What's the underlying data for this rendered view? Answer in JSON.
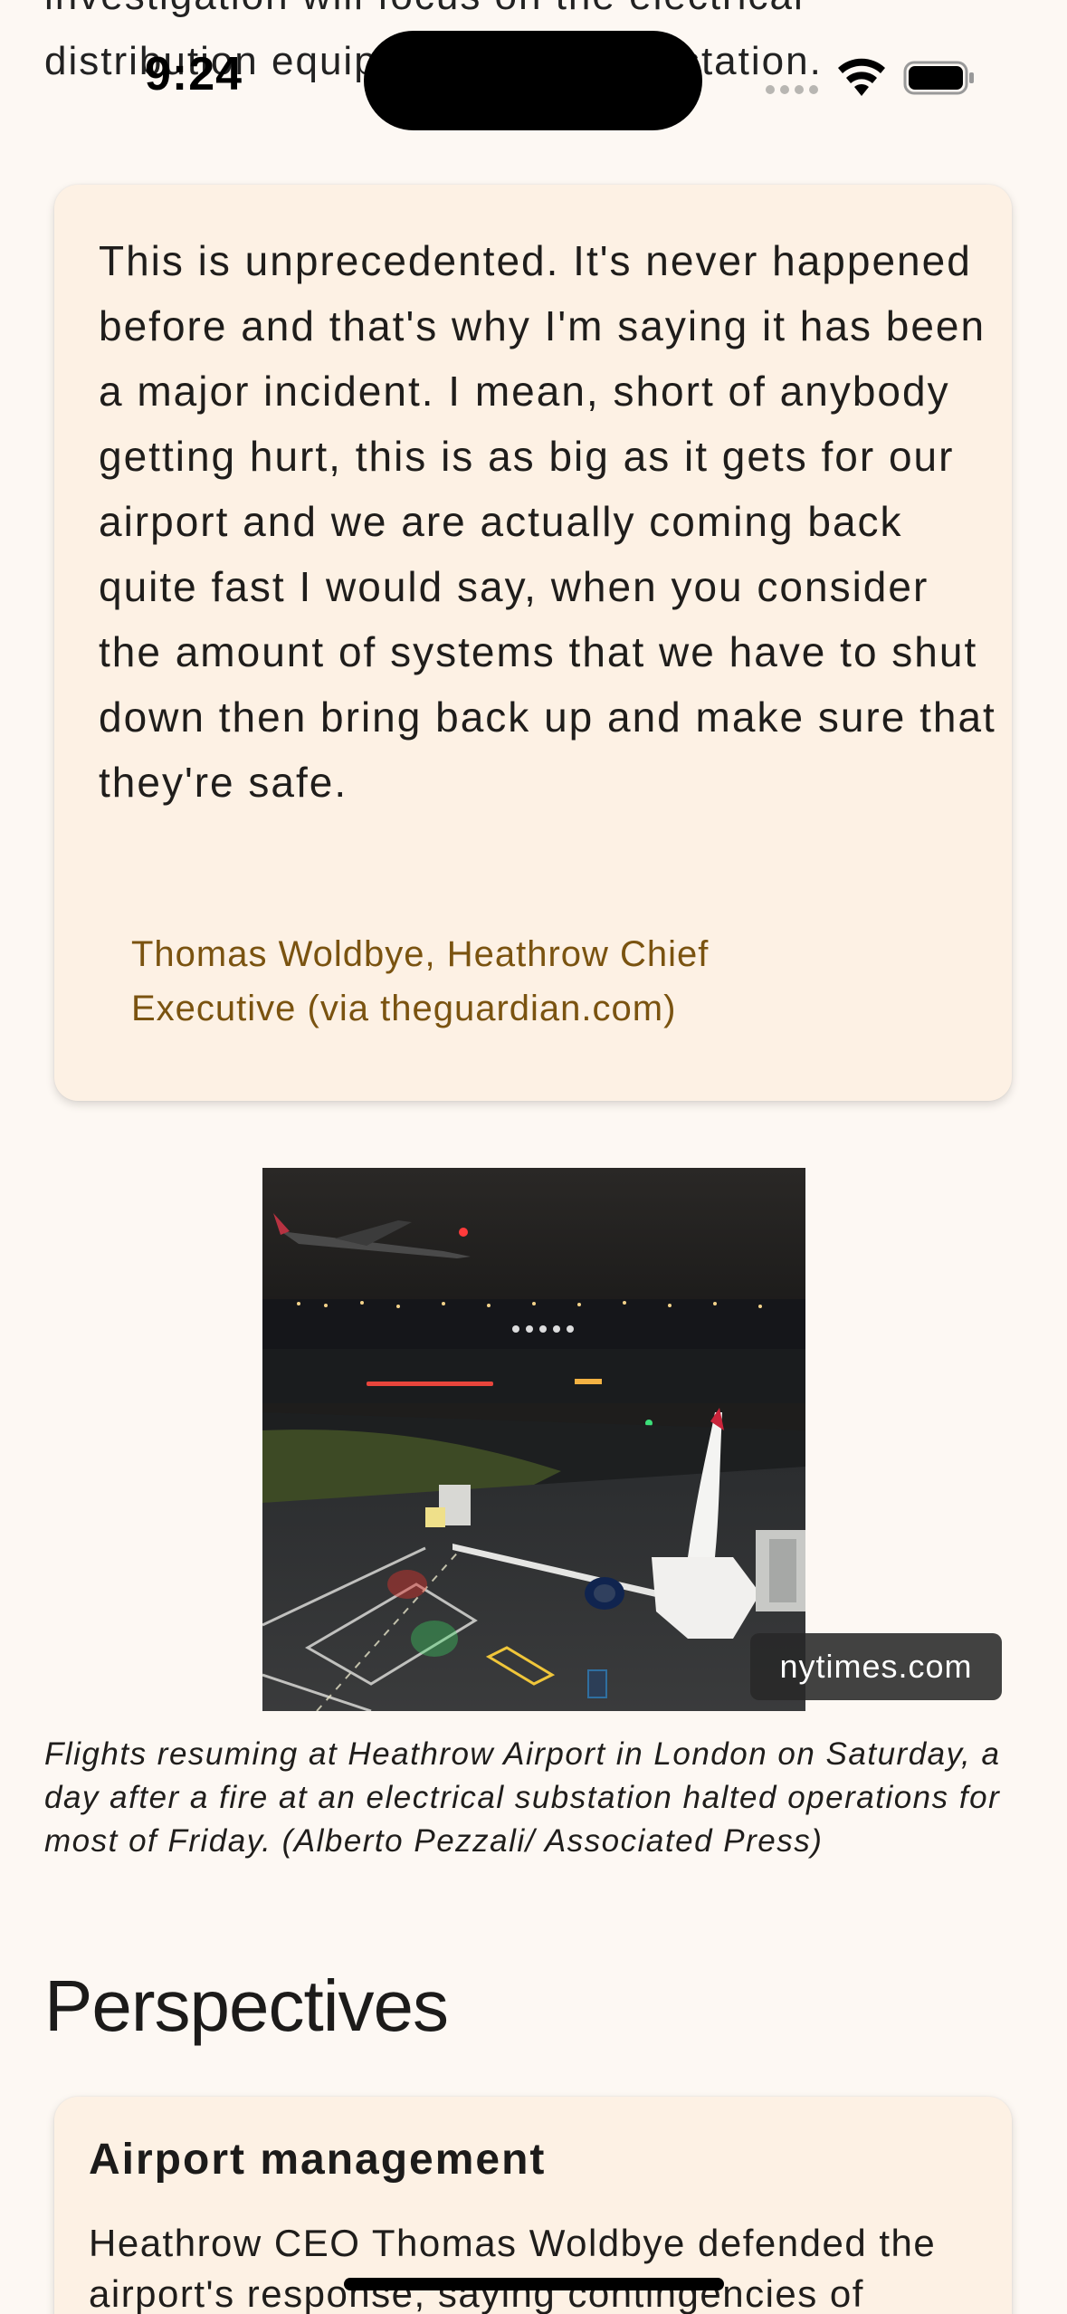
{
  "article": {
    "previous_paragraph": "investigation will focus on the electrical distribution equipment at the substation."
  },
  "status_bar": {
    "time": "9:24"
  },
  "quote": {
    "text": "This is unprecedented. It's never happened before and that's why I'm saying it has been a major incident. I mean, short of anybody getting hurt, this is as big as it gets for our airport and we are actually coming back quite fast I would say, when you consider the amount of systems that we have to shut down then bring back up and make sure that they're safe.",
    "attribution": "Thomas Woldbye, Heathrow Chief Executive (via theguardian.com)"
  },
  "image": {
    "source": "nytimes.com",
    "caption": "Flights resuming at Heathrow Airport in London on Saturday, a day after a fire at an electrical substation halted operations for most of Friday. (Alberto Pezzali/ Associated Press)"
  },
  "perspectives": {
    "heading": "Perspectives",
    "cards": [
      {
        "title": "Airport management",
        "body": "Heathrow CEO Thomas Woldbye defended the airport's response, saying contingencies of"
      }
    ]
  },
  "colors": {
    "background": "#fdf8f3",
    "card": "#fdf1e4",
    "attribution": "#7a5310"
  }
}
